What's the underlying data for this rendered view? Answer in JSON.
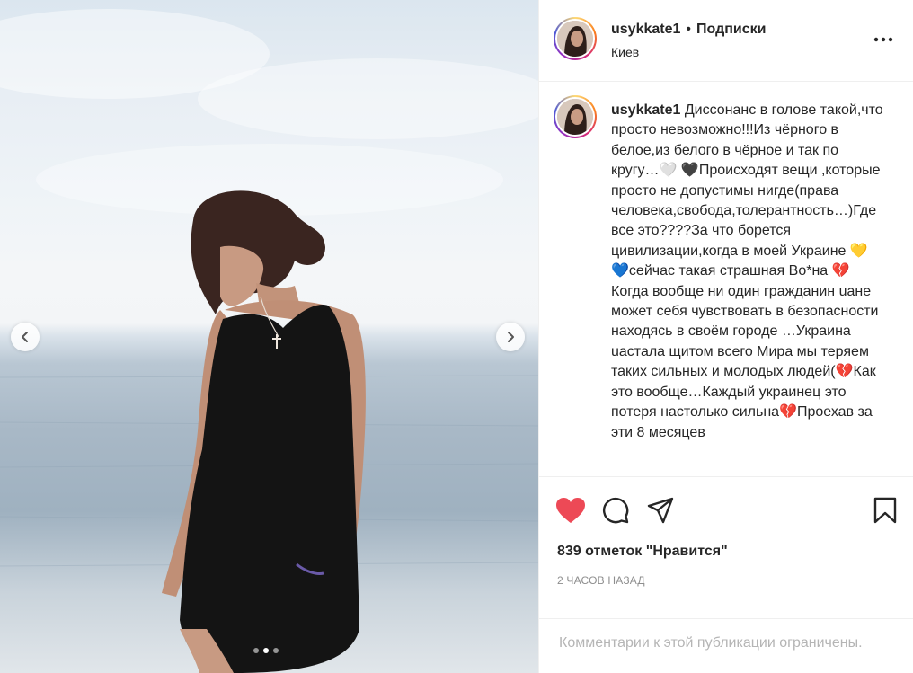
{
  "post": {
    "username": "usykkate1",
    "separator": "•",
    "follow_label": "Подписки",
    "location": "Киев",
    "caption": "Диссонанс в голове такой,что просто невозможно!!!Из чёрного в белое,из белого в чёрное и так по кругу…🤍 🖤Происходят вещи ,которые просто не допустимы нигде(права человека,свобода,толерантность…)Где все это????За что борется цивилизации,когда в моей Украине 💛 💙сейчас такая страшная Во*на 💔Когда вообще ни один гражданин uaне может себя чувствовать в безопасности находясь в своём городе …Украина uaстала щитом всего Мира мы теряем таких сильных и молодых людей(💔Как это вообще…Каждый украинец это потеря настолько сильна💔Проехав за эти 8 месяцев",
    "likes": "839 отметок \"Нравится\"",
    "time": "2 ЧАСОВ НАЗАД",
    "comments_restricted": "Комментарии к этой публикации ограничены.",
    "carousel": {
      "count": 3,
      "active_index": 1
    }
  },
  "colors": {
    "like": "#ed4956",
    "text": "#262626",
    "muted": "#8e8e8e",
    "border": "#efefef"
  },
  "icons": [
    "chevron-left-icon",
    "chevron-right-icon",
    "more-icon",
    "heart-icon",
    "comment-icon",
    "share-icon",
    "bookmark-icon"
  ]
}
